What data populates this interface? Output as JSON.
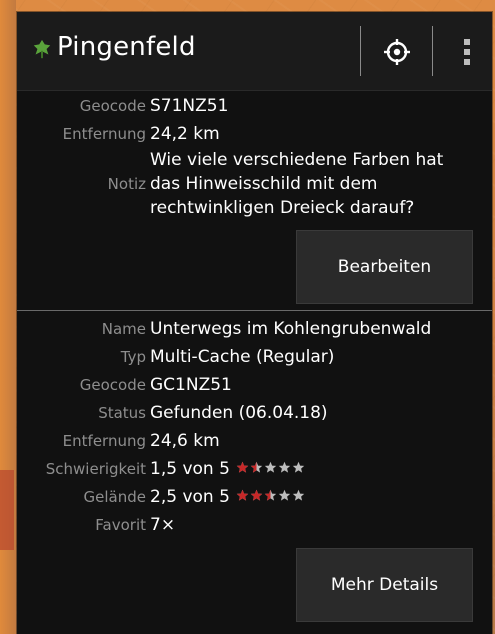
{
  "header": {
    "title": "Pingenfeld",
    "leaf_icon": "leaf-icon",
    "target_icon": "crosshair-target-icon",
    "menu_icon": "overflow-menu-icon"
  },
  "waypoint": {
    "geocode_label": "Geocode",
    "geocode_value": "S71NZ51",
    "distance_label": "Entfernung",
    "distance_value": "24,2 km",
    "note_label": "Notiz",
    "note_value": "Wie viele verschiedene Farben hat das Hinweisschild mit dem rechtwinkligen Dreieck darauf?",
    "edit_button": "Bearbeiten"
  },
  "cache": {
    "name_label": "Name",
    "name_value": "Unterwegs im Kohlengrubenwald",
    "type_label": "Typ",
    "type_value": "Multi-Cache (Regular)",
    "geocode_label": "Geocode",
    "geocode_value": "GC1NZ51",
    "status_label": "Status",
    "status_value": "Gefunden (06.04.18)",
    "distance_label": "Entfernung",
    "distance_value": "24,6 km",
    "difficulty_label": "Schwierigkeit",
    "difficulty_value": "1,5 von 5",
    "difficulty_rating": 1.5,
    "terrain_label": "Gelände",
    "terrain_value": "2,5 von 5",
    "terrain_rating": 2.5,
    "favorite_label": "Favorit",
    "favorite_value": "7×",
    "details_button": "Mehr Details"
  },
  "colors": {
    "star_filled": "#c62828",
    "star_empty": "#bdbdbd",
    "leaf": "#5aa33b"
  }
}
